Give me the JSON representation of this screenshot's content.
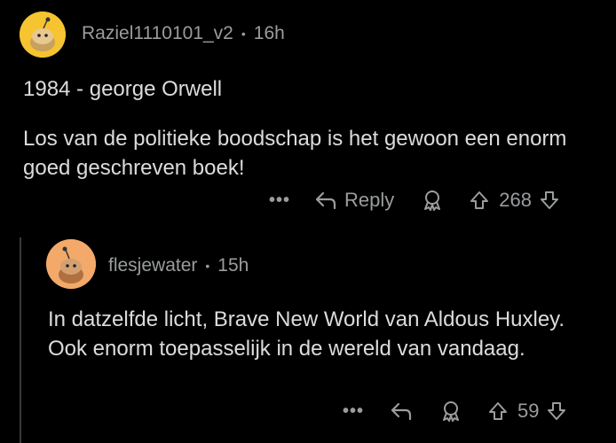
{
  "comments": [
    {
      "username": "Raziel1110101_v2",
      "time": "16h",
      "paragraphs": [
        "1984 - george Orwell",
        "Los van de politieke boodschap is het gewoon een enorm goed geschreven boek!"
      ],
      "reply_label": "Reply",
      "votes": "268",
      "avatar_color": "#f5c430"
    },
    {
      "username": "flesjewater",
      "time": "15h",
      "paragraphs": [
        "In datzelfde licht, Brave New World van Aldous Huxley. Ook enorm toepasselijk in de wereld van vandaag."
      ],
      "votes": "59",
      "avatar_color": "#f2a96a"
    }
  ],
  "icons": [
    "more-icon",
    "reply-icon",
    "award-icon",
    "upvote-icon",
    "downvote-icon"
  ]
}
